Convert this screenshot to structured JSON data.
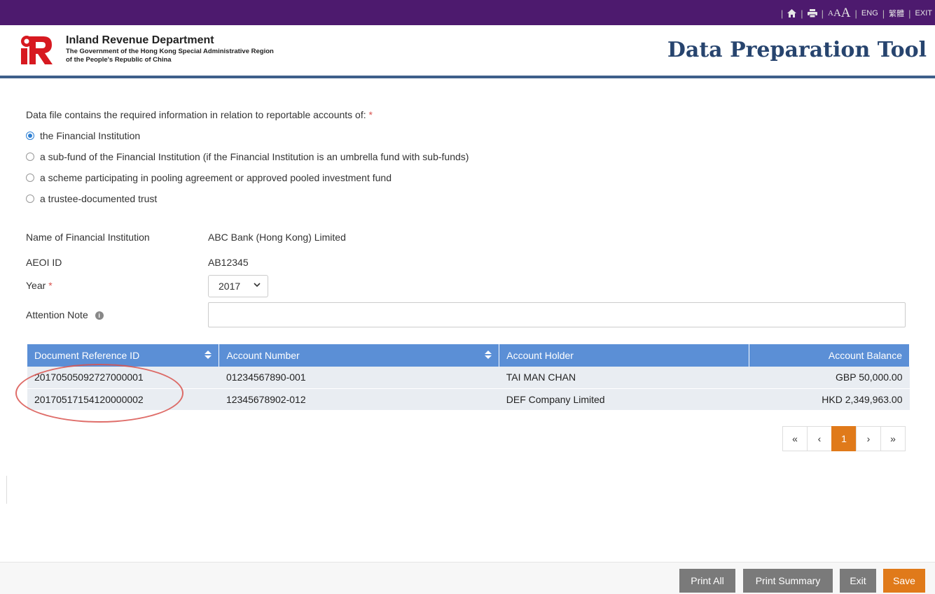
{
  "topbar": {
    "home_icon": "home-icon",
    "print_icon": "print-icon",
    "font_sizes": [
      "A",
      "A",
      "A"
    ],
    "lang_eng": "ENG",
    "lang_tc": "繁體",
    "exit": "EXIT"
  },
  "header": {
    "dept_name": "Inland Revenue Department",
    "dept_sub1": "The Government of the Hong Kong Special Administrative Region",
    "dept_sub2": "of the People's Republic of China",
    "app_title": "Data Preparation Tool"
  },
  "form": {
    "question": "Data file contains the required information in relation to reportable accounts of:",
    "required_mark": "*",
    "options": [
      {
        "label": "the Financial Institution",
        "checked": true
      },
      {
        "label": "a sub-fund of the Financial Institution (if the Financial Institution is an umbrella fund with sub-funds)",
        "checked": false
      },
      {
        "label": "a scheme participating in pooling agreement or approved pooled investment fund",
        "checked": false
      },
      {
        "label": "a trustee-documented trust",
        "checked": false
      }
    ],
    "fi_name_label": "Name of Financial Institution",
    "fi_name_value": "ABC Bank (Hong Kong) Limited",
    "aeoi_label": "AEOI ID",
    "aeoi_value": "AB12345",
    "year_label": "Year",
    "year_value": "2017",
    "attention_label": "Attention Note",
    "attention_value": ""
  },
  "table": {
    "headers": [
      "Document Reference ID",
      "Account Number",
      "Account Holder",
      "Account Balance"
    ],
    "rows": [
      [
        "20170505092727000001",
        "01234567890-001",
        "TAI MAN CHAN",
        "GBP 50,000.00"
      ],
      [
        "20170517154120000002",
        "12345678902-012",
        "DEF Company Limited",
        "HKD 2,349,963.00"
      ]
    ]
  },
  "pager": {
    "first": "«",
    "prev": "‹",
    "current": "1",
    "next": "›",
    "last": "»"
  },
  "footer": {
    "print_all": "Print All",
    "print_summary": "Print Summary",
    "exit": "Exit",
    "save": "Save"
  },
  "colors": {
    "topbar": "#4d1a6e",
    "header_rule": "#3e5f8a",
    "table_header": "#5b8fd6",
    "accent_orange": "#e07a1a",
    "button_gray": "#7a7a7a",
    "highlight_red": "#d9534f"
  }
}
